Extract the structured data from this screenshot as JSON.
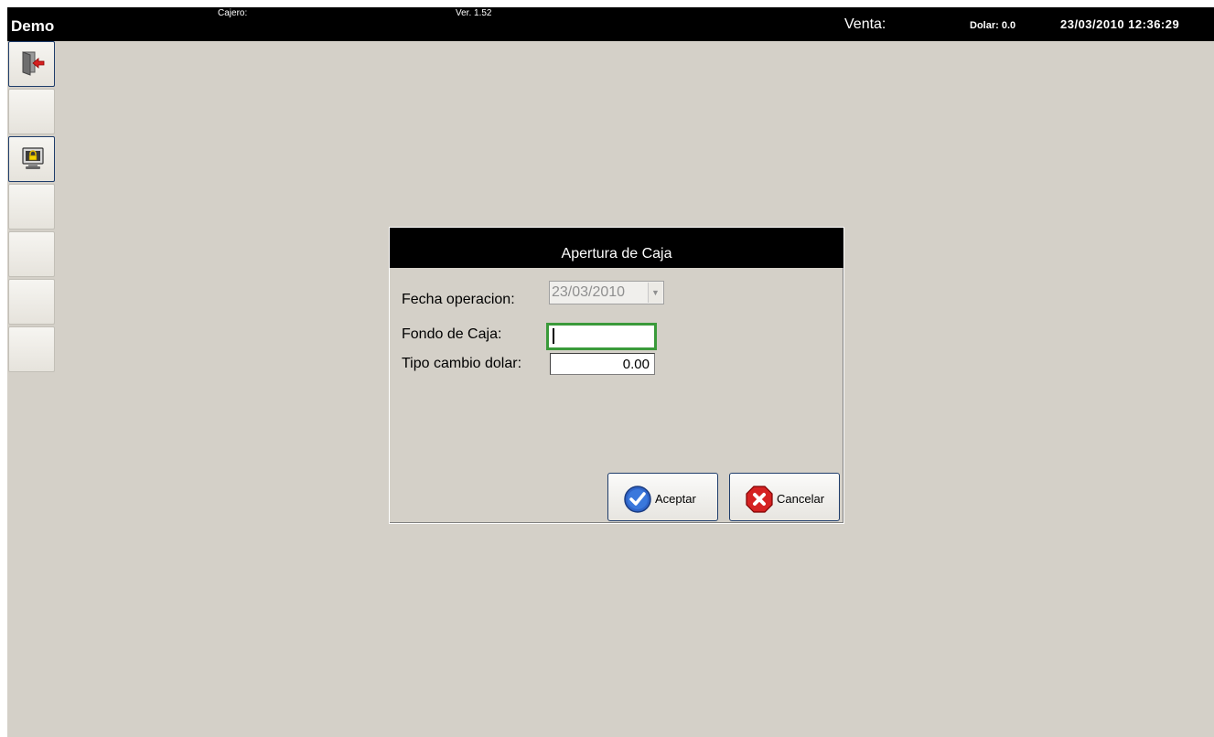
{
  "topbar": {
    "app_title": "Demo",
    "cajero_label": "Cajero:",
    "version": "Ver. 1.52",
    "venta_label": "Venta:",
    "dolar": "Dolar: 0.0",
    "datetime": "23/03/2010 12:36:29"
  },
  "sidebar": {
    "buttons": [
      {
        "icon": "exit-door-icon"
      },
      {
        "icon": ""
      },
      {
        "icon": "lock-screen-icon"
      },
      {
        "icon": ""
      },
      {
        "icon": ""
      },
      {
        "icon": ""
      },
      {
        "icon": ""
      }
    ]
  },
  "dialog": {
    "title": "Apertura de Caja",
    "fecha_label": "Fecha operacion:",
    "fecha_value": "23/03/2010",
    "fondo_label": "Fondo de Caja:",
    "fondo_value": "",
    "tipo_label": "Tipo cambio dolar:",
    "tipo_value": "0.00",
    "accept_label": "Aceptar",
    "cancel_label": "Cancelar"
  },
  "colors": {
    "background": "#d4d0c8",
    "bar": "#000000",
    "focus": "#3a9a3a"
  }
}
